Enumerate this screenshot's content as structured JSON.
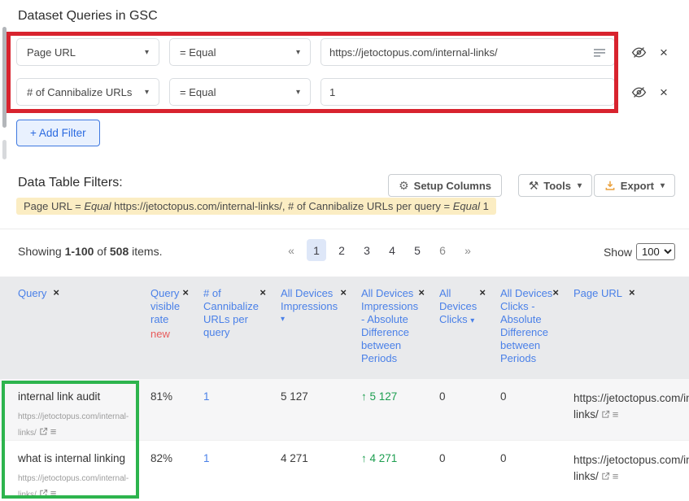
{
  "title": "Dataset Queries in GSC",
  "filter_builder": {
    "rows": [
      {
        "field": "Page URL",
        "operator": "= Equal",
        "value": "https://jetoctopus.com/internal-links/"
      },
      {
        "field": "# of Cannibalize URLs",
        "operator": "= Equal",
        "value": "1"
      }
    ],
    "add_filter": "+ Add Filter"
  },
  "toolbar": {
    "heading": "Data Table Filters:",
    "setup_columns": "Setup Columns",
    "tools": "Tools",
    "export": "Export"
  },
  "filter_summary": {
    "segments": [
      {
        "text": "Page URL = "
      },
      {
        "text": "Equal",
        "italic": true
      },
      {
        "text": " https://jetoctopus.com/internal-links/, # of Cannibalize URLs per query = "
      },
      {
        "text": "Equal",
        "italic": true
      },
      {
        "text": " 1"
      }
    ]
  },
  "list_controls": {
    "showing_prefix": "Showing",
    "range": "1-100",
    "of_word": "of",
    "total": "508",
    "items_word": "items.",
    "pagination": {
      "prev": "«",
      "pages": [
        "1",
        "2",
        "3",
        "4",
        "5",
        "6"
      ],
      "next": "»",
      "active_page": "1"
    },
    "show_label": "Show",
    "page_size": "100"
  },
  "table": {
    "headers": [
      {
        "label": "Query"
      },
      {
        "label": "Query visible rate",
        "badge": "new"
      },
      {
        "label": "# of Cannibalize URLs per query"
      },
      {
        "label": "All Devices Impressions",
        "sortable": true
      },
      {
        "label": "All Devices Impressions - Absolute Difference between Periods"
      },
      {
        "label": "All Devices Clicks",
        "sortable": true
      },
      {
        "label": "All Devices Clicks - Absolute Difference between Periods"
      },
      {
        "label": "Page URL"
      }
    ],
    "rows": [
      {
        "query": "internal link audit",
        "query_url": "https://jetoctopus.com/internal-links/",
        "visible_rate": "81%",
        "cannibalize_count": "1",
        "impressions": "5 127",
        "impressions_diff": "5 127",
        "clicks": "0",
        "clicks_diff": "0",
        "page_url": "https://jetoctopus.com/internal-links/"
      },
      {
        "query": "what is internal linking",
        "query_url": "https://jetoctopus.com/internal-links/",
        "visible_rate": "82%",
        "cannibalize_count": "1",
        "impressions": "4 271",
        "impressions_diff": "4 271",
        "clicks": "0",
        "clicks_diff": "0",
        "page_url": "https://jetoctopus.com/internal-links/"
      }
    ]
  },
  "icons": {
    "caret": "▾",
    "close": "×",
    "up_arrow": "↑",
    "gear": "⚙",
    "tools": "⚒",
    "hamburger": "≡"
  },
  "colors": {
    "accent_blue": "#4a80e8",
    "value_green": "#1d9e50",
    "annotation_red": "#d8232e",
    "annotation_green": "#2db44d",
    "summary_bg": "#fbedc3",
    "new_badge_red": "#e85c5c"
  }
}
